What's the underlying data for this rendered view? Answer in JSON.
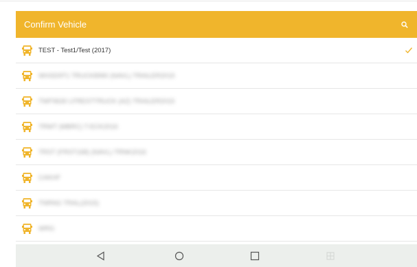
{
  "app_bar": {
    "title": "Confirm Vehicle",
    "background": "#f0b52c",
    "search_icon": "search-icon"
  },
  "vehicles": [
    {
      "label": "TEST - Test1/Test (2017)",
      "selected": true
    },
    {
      "label": "WHSD9T1 TRUCK8990 (NAVL) TRAILER2015",
      "selected": false
    },
    {
      "label": "TWF9630 LFRESTTRUCK (AZ) TRAILER2015",
      "selected": false
    },
    {
      "label": "TRWT (MBRC) T-ECK2016",
      "selected": false
    },
    {
      "label": "TRST (FRST168) (NAVL) TRNK2016",
      "selected": false
    },
    {
      "label": "CAKHF",
      "selected": false
    },
    {
      "label": "TNRNG TRAL(2015)",
      "selected": false
    },
    {
      "label": "WRG",
      "selected": false
    }
  ],
  "colors": {
    "accent": "#f0b52c",
    "check": "#f0b52c",
    "divider": "#e6e6e6",
    "nav_bar": "#ecefec"
  },
  "nav_bar": {
    "back_icon": "back-triangle-icon",
    "home_icon": "home-circle-icon",
    "recents_icon": "recents-square-icon",
    "extra_icon": "grid-icon"
  }
}
